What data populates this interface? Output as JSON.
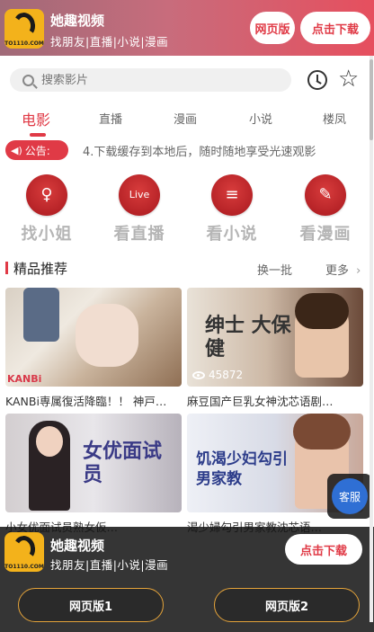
{
  "banner": {
    "logo_text": "TO1110.COM",
    "app_name": "她趣视频",
    "tagline": "找朋友|直播|小说|漫画",
    "web_button": "网页版",
    "download_button": "点击下载"
  },
  "search": {
    "placeholder": "搜索影片"
  },
  "icons": {
    "history": "clock-icon",
    "favorites": "star-icon"
  },
  "tabs": [
    {
      "label": "电影",
      "active": true
    },
    {
      "label": "直播",
      "active": false
    },
    {
      "label": "漫画",
      "active": false
    },
    {
      "label": "小说",
      "active": false
    },
    {
      "label": "楼凤",
      "active": false
    }
  ],
  "notice": {
    "badge": "公告:",
    "text": "4.下载缓存到本地后，随时随地享受光速观影"
  },
  "quick_links": [
    {
      "label": "找小姐",
      "icon": "girl-icon"
    },
    {
      "label": "看直播",
      "icon": "live-icon"
    },
    {
      "label": "看小说",
      "icon": "book-icon"
    },
    {
      "label": "看漫画",
      "icon": "comic-icon"
    }
  ],
  "section": {
    "title": "精品推荐",
    "refresh": "换一批",
    "more": "更多"
  },
  "videos": [
    {
      "caption": "KANBi専属復活降臨！！ 神戸…",
      "views": "",
      "thumb_text": "KANBi"
    },
    {
      "caption": "麻豆国产巨乳女神沈芯语剧…",
      "views": "45872",
      "thumb_text": "绅士 大保健"
    },
    {
      "caption": "小女优面试员熟女仮…",
      "views": "",
      "thumb_text": "女优面试员"
    },
    {
      "caption": "渴少婦勾引男家教沈芯语…",
      "views": "",
      "thumb_text": "饥渴少妇勾引男家教"
    }
  ],
  "service_button": "客服",
  "bottom": {
    "app_name": "她趣视频",
    "tagline": "找朋友|直播|小说|漫画",
    "download_button": "点击下载",
    "web1": "网页版1",
    "web2": "网页版2"
  },
  "colors": {
    "accent": "#e03a46",
    "logo_bg": "#f3b21b"
  }
}
